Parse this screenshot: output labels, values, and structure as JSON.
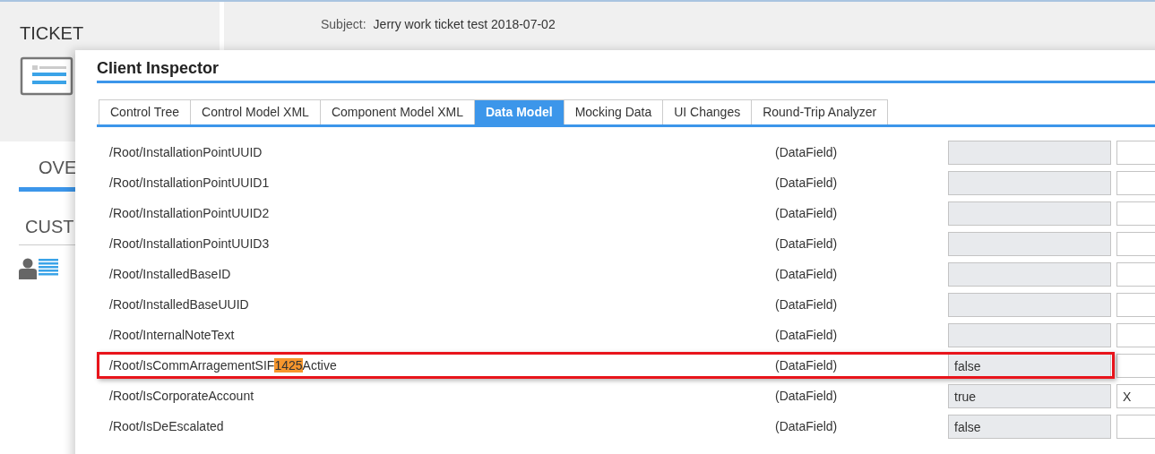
{
  "page": {
    "section_title": "TICKET",
    "subject_label": "Subject:",
    "subject_value": "Jerry work ticket test 2018-07-02",
    "tabs": [
      {
        "label": "OVE",
        "selected": true
      },
      {
        "label": "CUST",
        "selected": false
      }
    ]
  },
  "dialog": {
    "title": "Client Inspector",
    "tabs": [
      {
        "label": "Control Tree",
        "selected": false
      },
      {
        "label": "Control Model XML",
        "selected": false
      },
      {
        "label": "Component Model XML",
        "selected": false
      },
      {
        "label": "Data Model",
        "selected": true
      },
      {
        "label": "Mocking Data",
        "selected": false
      },
      {
        "label": "UI Changes",
        "selected": false
      },
      {
        "label": "Round-Trip Analyzer",
        "selected": false
      }
    ],
    "rows": [
      {
        "path": [
          {
            "text": "/Root/InstallationPointUUID",
            "highlighted": false
          }
        ],
        "type": "(DataField)",
        "outlined": false
      },
      {
        "path": [
          {
            "text": "/Root/InstallationPointUUID1",
            "highlighted": false
          }
        ],
        "type": "(DataField)",
        "outlined": false
      },
      {
        "path": [
          {
            "text": "/Root/InstallationPointUUID2",
            "highlighted": false
          }
        ],
        "type": "(DataField)",
        "outlined": false
      },
      {
        "path": [
          {
            "text": "/Root/InstallationPointUUID3",
            "highlighted": false
          }
        ],
        "type": "(DataField)",
        "outlined": false
      },
      {
        "path": [
          {
            "text": "/Root/InstalledBaseID",
            "highlighted": false
          }
        ],
        "type": "(DataField)",
        "outlined": false
      },
      {
        "path": [
          {
            "text": "/Root/InstalledBaseUUID",
            "highlighted": false
          }
        ],
        "type": "(DataField)",
        "outlined": false
      },
      {
        "path": [
          {
            "text": "/Root/InternalNoteText",
            "highlighted": false
          }
        ],
        "type": "(DataField)",
        "outlined": false
      },
      {
        "path": [
          {
            "text": "/Root/IsCommArragementSIF",
            "highlighted": false
          },
          {
            "text": "1425",
            "highlighted": true
          },
          {
            "text": "Active",
            "highlighted": false
          }
        ],
        "type": "(DataField)",
        "value": "false",
        "outlined": true
      },
      {
        "path": [
          {
            "text": "/Root/IsCorporateAccount",
            "highlighted": false
          }
        ],
        "type": "(DataField)",
        "value": "true",
        "mock": "X",
        "outlined": false
      },
      {
        "path": [
          {
            "text": "/Root/IsDeEscalated",
            "highlighted": false
          }
        ],
        "type": "(DataField)",
        "value": "false",
        "outlined": false
      }
    ]
  }
}
